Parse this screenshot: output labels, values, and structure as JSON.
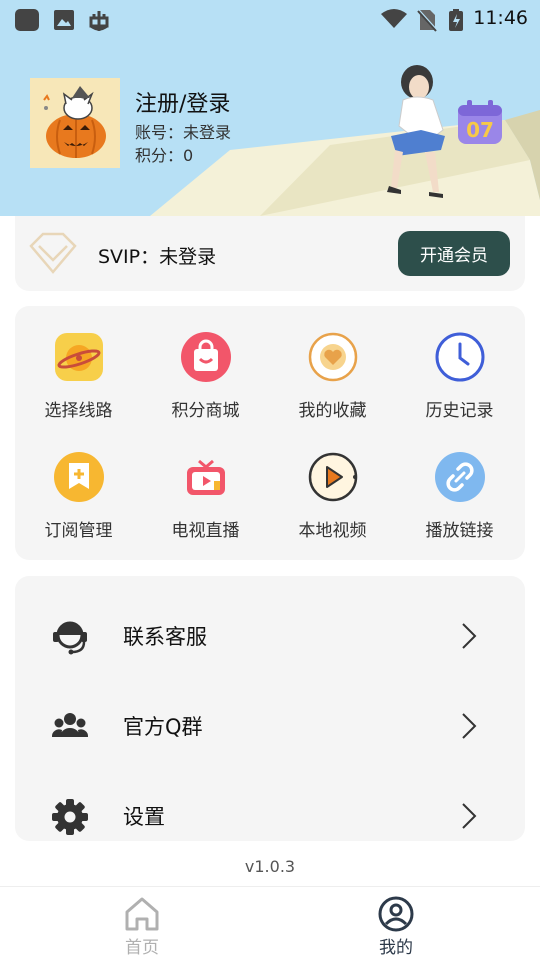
{
  "status_bar": {
    "time": "11:46"
  },
  "user": {
    "title": "注册/登录",
    "account": "账号：未登录",
    "points": "积分：0",
    "calendar_day": "07"
  },
  "svip": {
    "label": "SVIP：未登录",
    "button": "开通会员"
  },
  "grid": [
    {
      "label": "选择线路",
      "icon": "planet-icon"
    },
    {
      "label": "积分商城",
      "icon": "shopping-bag-icon"
    },
    {
      "label": "我的收藏",
      "icon": "heart-icon"
    },
    {
      "label": "历史记录",
      "icon": "clock-icon"
    },
    {
      "label": "订阅管理",
      "icon": "bookmark-plus-icon"
    },
    {
      "label": "电视直播",
      "icon": "tv-icon"
    },
    {
      "label": "本地视频",
      "icon": "play-icon"
    },
    {
      "label": "播放链接",
      "icon": "link-icon"
    }
  ],
  "list": [
    {
      "label": "联系客服",
      "icon": "headset-icon"
    },
    {
      "label": "官方Q群",
      "icon": "group-icon"
    },
    {
      "label": "设置",
      "icon": "gear-icon"
    }
  ],
  "version": "v1.0.3",
  "nav": [
    {
      "label": "首页",
      "icon": "home-icon",
      "color": "#b0b0b0"
    },
    {
      "label": "我的",
      "icon": "user-icon",
      "color": "#2d3a4a"
    }
  ],
  "colors": {
    "header_bg": "#b7e0f5",
    "accent": "#2d4f4b",
    "card_bg": "#f5f5f5"
  }
}
